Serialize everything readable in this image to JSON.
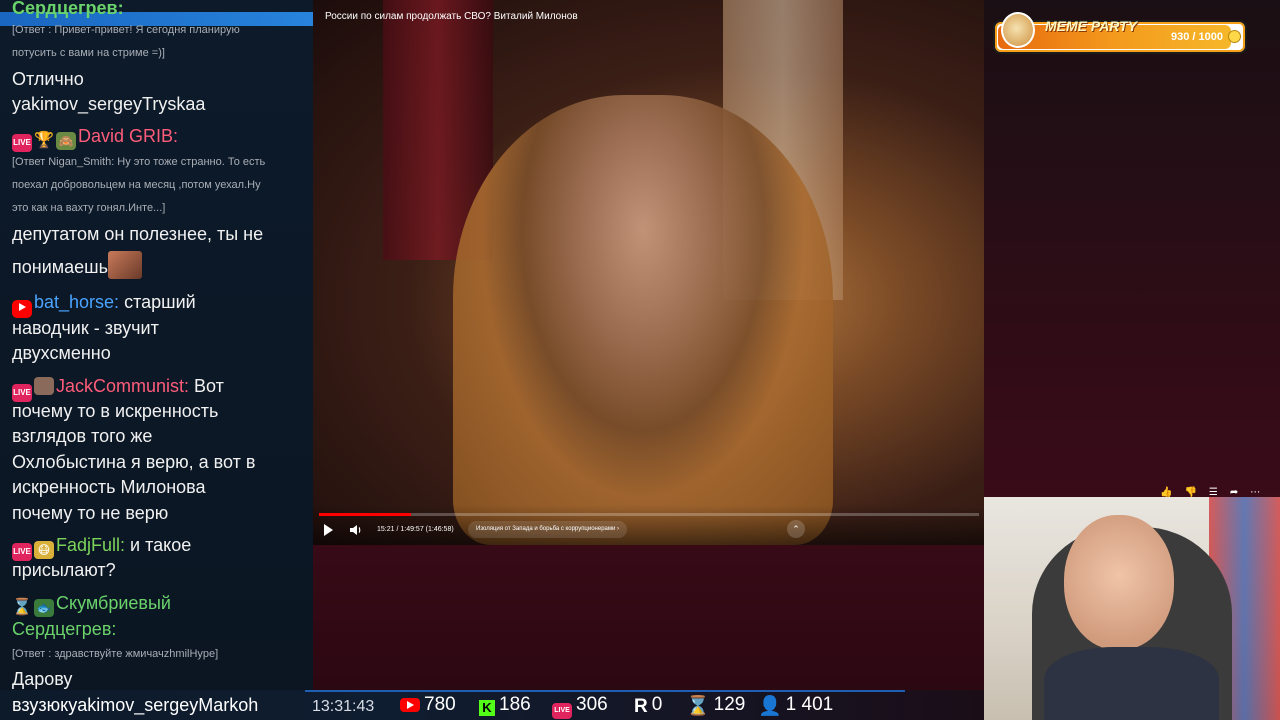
{
  "chat": {
    "top_name": "Сердцегрев:",
    "messages": [
      {
        "type": "reply",
        "text": "[Ответ : Привет-привет! Я сегодня планирую"
      },
      {
        "type": "reply",
        "text": "потусить с вами на стриме =)]"
      },
      {
        "type": "text",
        "text": "Отлично"
      },
      {
        "type": "text",
        "text": "yakimov_sergeyTryskaa"
      },
      {
        "nick": "David GRIB:",
        "nick_color": "#ff5c7a"
      },
      {
        "type": "reply",
        "text": "[Ответ Nigan_Smith: Ну это тоже странно. То есть"
      },
      {
        "type": "reply",
        "text": "поехал добровольцем на месяц ,потом уехал.Ну"
      },
      {
        "type": "reply",
        "text": "это как на вахту гонял.Инте...]"
      },
      {
        "type": "text",
        "text": "депутатом он полезнее, ты не"
      },
      {
        "type": "text",
        "text": "понимаешь"
      },
      {
        "nick": "bat_horse:",
        "nick_color": "#4aa3ff",
        "text": "старший"
      },
      {
        "type": "text",
        "text": "наводчик - звучит"
      },
      {
        "type": "text",
        "text": "двухсменно"
      },
      {
        "nick": "JackCommunist:",
        "nick_color": "#ff5c7a",
        "text": "Вот"
      },
      {
        "type": "text",
        "text": "почему то в искренность"
      },
      {
        "type": "text",
        "text": "взглядов того же"
      },
      {
        "type": "text",
        "text": "Охлобыстина я верю, а вот в"
      },
      {
        "type": "text",
        "text": "искренность Милонова"
      },
      {
        "type": "text",
        "text": "почему то не верю"
      },
      {
        "nick": "FadjFull:",
        "nick_color": "#7cd35a",
        "text": "и такое"
      },
      {
        "type": "text",
        "text": "присылают?"
      },
      {
        "nick": "Скумбриевый",
        "nick_color": "#6ad36a"
      },
      {
        "type": "text",
        "text": "Сердцегрев:",
        "color": "#6ad36a"
      },
      {
        "type": "reply",
        "text": "[Ответ : здравствуйте жмичачzhmilHype]"
      },
      {
        "type": "text",
        "text": "Дарову"
      },
      {
        "type": "text",
        "text": "взузюкуakimov_sergeyMarkoh"
      }
    ]
  },
  "video": {
    "title": "России по силам продолжать СВО? Виталий Милонов",
    "time": "15:21 / 1:49:57 (1:46:58)",
    "chapter": "Изоляция от Запада и борьба с коррупционерами",
    "progress": 0.14
  },
  "meme_party": {
    "title": "MEME PARTY",
    "count": "930 / 1000",
    "progress": 0.93
  },
  "stats": {
    "clock": "13:31:43",
    "youtube": "780",
    "kick": "186",
    "vkplay": "306",
    "rutube": "0",
    "twitch": "129",
    "total": "1 401"
  }
}
